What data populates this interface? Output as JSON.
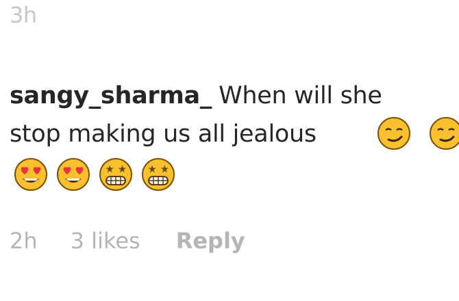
{
  "previous_comment": {
    "timestamp": "3h"
  },
  "comment": {
    "username": "sangy_sharma_",
    "text_line1": "When will she",
    "text_line2": "stop making us all jealous",
    "emojis": [
      "smirking-face-emoji",
      "smirking-face-emoji",
      "heart-eyes-emoji",
      "heart-eyes-emoji",
      "star-struck-grin-emoji",
      "star-struck-grin-emoji"
    ]
  },
  "actions": {
    "timestamp": "2h",
    "likes": "3 likes",
    "reply": "Reply"
  },
  "colors": {
    "text_primary": "#262626",
    "text_secondary": "#b5b5b5",
    "emoji_yellow": "#fbc02d",
    "heart_red": "#e8333b"
  }
}
